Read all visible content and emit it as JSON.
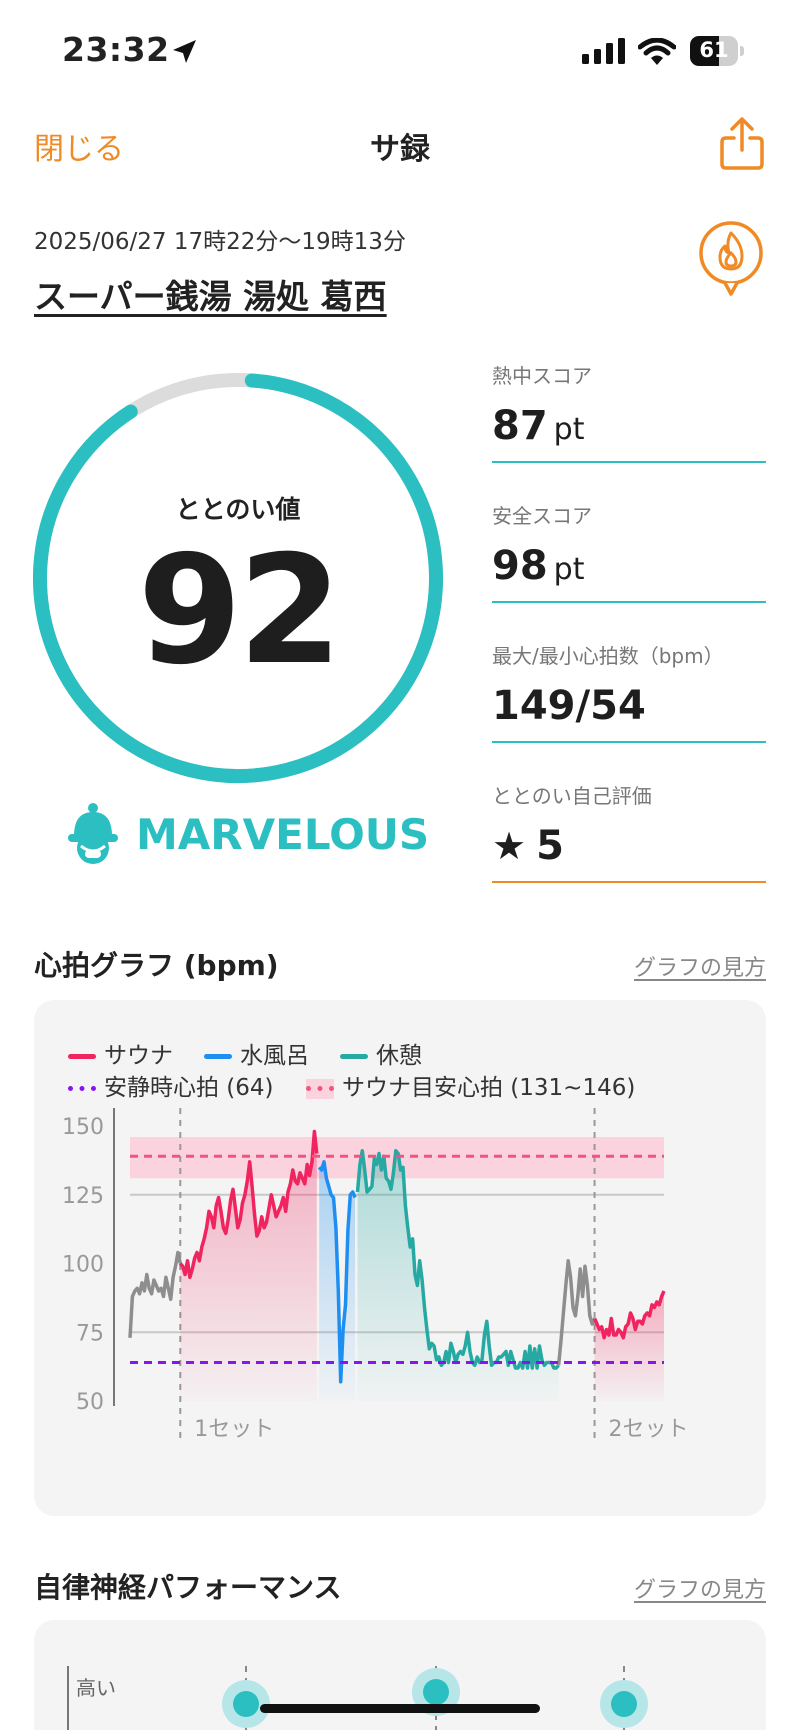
{
  "status_bar": {
    "time": "23:32",
    "battery": "61"
  },
  "nav": {
    "close_label": "閉じる",
    "title": "サ録"
  },
  "session": {
    "datetime": "2025/06/27 17時22分〜19時13分",
    "facility": "スーパー銭湯 湯処 葛西"
  },
  "score": {
    "label": "ととのい値",
    "value": "92",
    "progress": 0.92,
    "rating": "MARVELOUS"
  },
  "metrics": [
    {
      "label": "熱中スコア",
      "value": "87",
      "unit": "pt"
    },
    {
      "label": "安全スコア",
      "value": "98",
      "unit": "pt"
    },
    {
      "label": "最大/最小心拍数（bpm）",
      "value": "149/54",
      "unit": ""
    },
    {
      "label": "ととのい自己評価",
      "value": "5",
      "unit": ""
    }
  ],
  "heart_section": {
    "title": "心拍グラフ (bpm)",
    "link": "グラフの見方"
  },
  "autonomic_section": {
    "title": "自律神経パフォーマンス",
    "link": "グラフの見方",
    "y_high": "高い"
  },
  "colors": {
    "accent": "#2bbfc2",
    "orange": "#f08a24",
    "sauna": "#f0245f",
    "water": "#1e8ff0",
    "rest": "#26a9a2",
    "resting_hr": "#8a14f0",
    "target_hr": "#ee5582",
    "other": "#8e8e8e"
  },
  "chart_data": {
    "type": "line",
    "ylim": [
      50,
      150
    ],
    "yticks": [
      150,
      125,
      100,
      75,
      50
    ],
    "legend": [
      {
        "name": "サウナ",
        "color": "#f0245f",
        "style": "solid"
      },
      {
        "name": "水風呂",
        "color": "#1e8ff0",
        "style": "solid"
      },
      {
        "name": "休憩",
        "color": "#26a9a2",
        "style": "solid"
      },
      {
        "name": "安静時心拍 (64)",
        "color": "#8a14f0",
        "style": "dotted"
      },
      {
        "name": "サウナ目安心拍 (131~146)",
        "color": "#ee5582",
        "style": "dotted"
      }
    ],
    "resting_hr": 64,
    "target_band": [
      131,
      146
    ],
    "target_line": 139,
    "set_labels": [
      "1セット",
      "2セット"
    ],
    "x": [
      0,
      0.5,
      1,
      1.5,
      2,
      2.5,
      3,
      3.5,
      4,
      4.5,
      5,
      5.5,
      6,
      6.5,
      7,
      7.5,
      8,
      8.5,
      9,
      9.5,
      10,
      10.5,
      11,
      11.5,
      12,
      12.5,
      13,
      13.5,
      14,
      14.5,
      15,
      15.5,
      16,
      16.5,
      17,
      17.5,
      18,
      18.5,
      19,
      19.5,
      20,
      20.5,
      21,
      21.5,
      22,
      22.5,
      23,
      23.5,
      24,
      24.5,
      25,
      25.5,
      26,
      26.5,
      27,
      27.5,
      28,
      28.5,
      29,
      29.5,
      30,
      30.5,
      31,
      31.5,
      32,
      32.5,
      33,
      33.5,
      34,
      34.5,
      35,
      35.5,
      36,
      36.5,
      37,
      37.5,
      38,
      38.5,
      39,
      39.5,
      40,
      40.5,
      41,
      41.5,
      42,
      42.5,
      43,
      43.5,
      44,
      44.5,
      45,
      45.5,
      46,
      46.5,
      47,
      47.5,
      48,
      48.5,
      49,
      49.5,
      50,
      50.5,
      51,
      51.5,
      52,
      52.5,
      53,
      53.5,
      54,
      54.5,
      55,
      55.5,
      56,
      56.5,
      57,
      57.5,
      58,
      58.5,
      59,
      59.5,
      60,
      60.5,
      61,
      61.5,
      62,
      62.5,
      63,
      63.5,
      64,
      64.5,
      65,
      65.5,
      66,
      66.5,
      67,
      67.5,
      68,
      68.5,
      69,
      69.5,
      70,
      70.5,
      71,
      71.5,
      72,
      72.5,
      73,
      73.5,
      74,
      74.5,
      75,
      75.5,
      76,
      76.5,
      77,
      77.5,
      78,
      78.5,
      79,
      79.5,
      80,
      80.5,
      81,
      81.5,
      82,
      82.5,
      83,
      83.5,
      84,
      84.5,
      85,
      85.5,
      86,
      86.5,
      87,
      87.5,
      88,
      88.5,
      89,
      89.5,
      90,
      90.5,
      91,
      91.5,
      92,
      92.5,
      93,
      93.5,
      94,
      94.5,
      95,
      95.5,
      96,
      96.5,
      97,
      97.5,
      98,
      98.5,
      99,
      99.5,
      100,
      100.5,
      101,
      101.5,
      102,
      102.5,
      103,
      103.5,
      104,
      104.5,
      105,
      105.5,
      106,
      106.5,
      107,
      107.5,
      108,
      108.5,
      109,
      109.5,
      110,
      110.5,
      111,
      111.5
    ],
    "series": [
      {
        "name": "その他",
        "color": "#8e8e8e",
        "segments": [
          [
            0,
            73
          ],
          [
            0.5,
            88
          ],
          [
            1,
            90
          ],
          [
            1.5,
            91
          ],
          [
            2,
            89
          ],
          [
            2.5,
            93
          ],
          [
            3,
            90
          ],
          [
            3.5,
            96
          ],
          [
            4,
            91
          ],
          [
            4.5,
            89
          ],
          [
            5,
            94
          ],
          [
            5.5,
            92
          ],
          [
            6,
            90
          ],
          [
            6.5,
            91
          ],
          [
            7,
            88
          ],
          [
            7.5,
            95
          ],
          [
            8,
            91
          ],
          [
            8.5,
            87
          ],
          [
            9,
            95
          ],
          [
            9.5,
            99
          ],
          [
            10,
            104
          ],
          [
            10.5,
            100
          ]
        ]
      },
      {
        "name": "サウナ",
        "color": "#f0245f",
        "segments": [
          [
            10.5,
            100
          ],
          [
            11,
            99
          ],
          [
            11.5,
            96
          ],
          [
            12,
            101
          ],
          [
            12.5,
            95
          ],
          [
            13,
            98
          ],
          [
            13.5,
            102
          ],
          [
            14,
            104
          ],
          [
            14.5,
            101
          ],
          [
            15,
            106
          ],
          [
            15.5,
            109
          ],
          [
            16,
            113
          ],
          [
            16.5,
            119
          ],
          [
            17,
            117
          ],
          [
            17.5,
            113
          ],
          [
            18,
            121
          ],
          [
            18.5,
            124
          ],
          [
            19,
            119
          ],
          [
            19.5,
            113
          ],
          [
            20,
            111
          ],
          [
            20.5,
            116
          ],
          [
            21,
            123
          ],
          [
            21.5,
            127
          ],
          [
            22,
            120
          ],
          [
            22.5,
            113
          ],
          [
            23,
            116
          ],
          [
            23.5,
            122
          ],
          [
            24,
            125
          ],
          [
            24.5,
            130
          ],
          [
            25,
            137
          ],
          [
            25.5,
            128
          ],
          [
            26,
            118
          ],
          [
            26.5,
            110
          ],
          [
            27,
            112
          ],
          [
            27.5,
            117
          ],
          [
            28,
            113
          ],
          [
            28.5,
            115
          ],
          [
            29,
            120
          ],
          [
            29.5,
            125
          ],
          [
            30,
            121
          ],
          [
            30.5,
            117
          ],
          [
            31,
            119
          ],
          [
            31.5,
            121
          ],
          [
            32,
            124
          ],
          [
            32.5,
            119
          ],
          [
            33,
            126
          ],
          [
            33.5,
            129
          ],
          [
            34,
            134
          ],
          [
            34.5,
            130
          ],
          [
            35,
            129
          ],
          [
            35.5,
            133
          ],
          [
            36,
            131
          ],
          [
            36.5,
            129
          ],
          [
            37,
            136
          ],
          [
            37.5,
            132
          ],
          [
            38,
            137
          ],
          [
            38.5,
            148
          ],
          [
            39,
            140
          ]
        ]
      },
      {
        "name": "水風呂",
        "color": "#1e8ff0",
        "segments": [
          [
            39.5,
            135
          ],
          [
            40,
            134
          ],
          [
            40.5,
            137
          ],
          [
            41,
            131
          ],
          [
            41.5,
            128
          ],
          [
            42,
            125
          ],
          [
            42.5,
            124
          ],
          [
            43,
            113
          ],
          [
            43.5,
            90
          ],
          [
            44,
            57
          ],
          [
            44.5,
            76
          ],
          [
            45,
            85
          ],
          [
            45.5,
            112
          ],
          [
            46,
            125
          ],
          [
            46.5,
            126
          ],
          [
            47,
            124
          ]
        ]
      },
      {
        "name": "休憩",
        "color": "#26a9a2",
        "segments": [
          [
            47.5,
            126
          ],
          [
            48,
            136
          ],
          [
            48.5,
            141
          ],
          [
            49,
            134
          ],
          [
            49.5,
            126
          ],
          [
            50,
            127
          ],
          [
            50.5,
            128
          ],
          [
            51,
            138
          ],
          [
            51.5,
            136
          ],
          [
            52,
            140
          ],
          [
            52.5,
            134
          ],
          [
            53,
            139
          ],
          [
            53.5,
            131
          ],
          [
            54,
            130
          ],
          [
            54.5,
            127
          ],
          [
            55,
            133
          ],
          [
            55.5,
            141
          ],
          [
            56,
            140
          ],
          [
            56.5,
            134
          ],
          [
            57,
            135
          ],
          [
            57.5,
            121
          ],
          [
            58,
            113
          ],
          [
            58.5,
            106
          ],
          [
            59,
            109
          ],
          [
            59.5,
            96
          ],
          [
            60,
            92
          ],
          [
            60.5,
            101
          ],
          [
            61,
            94
          ],
          [
            61.5,
            84
          ],
          [
            62,
            76
          ],
          [
            62.5,
            69
          ],
          [
            63,
            71
          ],
          [
            63.5,
            70
          ],
          [
            64,
            65
          ],
          [
            64.5,
            66
          ],
          [
            65,
            63
          ],
          [
            65.5,
            64
          ],
          [
            66,
            68
          ],
          [
            66.5,
            64
          ],
          [
            67,
            71
          ],
          [
            67.5,
            68
          ],
          [
            68,
            64
          ],
          [
            68.5,
            67
          ],
          [
            69,
            68
          ],
          [
            69.5,
            67
          ],
          [
            70,
            70
          ],
          [
            70.5,
            75
          ],
          [
            71,
            68
          ],
          [
            71.5,
            64
          ],
          [
            72,
            63
          ],
          [
            72.5,
            66
          ],
          [
            73,
            64
          ],
          [
            73.5,
            65
          ],
          [
            74,
            74
          ],
          [
            74.5,
            79
          ],
          [
            75,
            70
          ],
          [
            75.5,
            63
          ],
          [
            76,
            64
          ],
          [
            76.5,
            64
          ],
          [
            77,
            66
          ],
          [
            77.5,
            66
          ],
          [
            78,
            67
          ],
          [
            78.5,
            68
          ],
          [
            79,
            63
          ],
          [
            79.5,
            68
          ],
          [
            80,
            65
          ],
          [
            80.5,
            62
          ],
          [
            81,
            62
          ],
          [
            81.5,
            64
          ],
          [
            82,
            62
          ],
          [
            82.5,
            68
          ],
          [
            83,
            62
          ],
          [
            83.5,
            70
          ],
          [
            84,
            62
          ],
          [
            84.5,
            69
          ],
          [
            85,
            62
          ],
          [
            85.5,
            70
          ],
          [
            86,
            65
          ],
          [
            86.5,
            63
          ],
          [
            87,
            64
          ],
          [
            87.5,
            64
          ],
          [
            88,
            64
          ],
          [
            88.5,
            62
          ],
          [
            89,
            62
          ],
          [
            89.5,
            63
          ]
        ]
      },
      {
        "name": "その他2",
        "color": "#8e8e8e",
        "segments": [
          [
            89.5,
            63
          ],
          [
            90,
            72
          ],
          [
            90.5,
            82
          ],
          [
            91,
            92
          ],
          [
            91.5,
            101
          ],
          [
            92,
            95
          ],
          [
            92.5,
            84
          ],
          [
            93,
            81
          ],
          [
            93.5,
            88
          ],
          [
            94,
            98
          ],
          [
            94.5,
            88
          ],
          [
            95,
            99
          ],
          [
            95.5,
            92
          ],
          [
            96,
            81
          ],
          [
            96.5,
            78
          ],
          [
            97,
            80
          ]
        ]
      },
      {
        "name": "サウナ2",
        "color": "#f0245f",
        "segments": [
          [
            97,
            80
          ],
          [
            97.5,
            78
          ],
          [
            98,
            76
          ],
          [
            98.5,
            77
          ],
          [
            99,
            73
          ],
          [
            99.5,
            76
          ],
          [
            100,
            74
          ],
          [
            100.5,
            80
          ],
          [
            101,
            74
          ],
          [
            101.5,
            74
          ],
          [
            102,
            76
          ],
          [
            102.5,
            75
          ],
          [
            103,
            73
          ],
          [
            103.5,
            77
          ],
          [
            104,
            78
          ],
          [
            104.5,
            82
          ],
          [
            105,
            80
          ],
          [
            105.5,
            76
          ],
          [
            106,
            79
          ],
          [
            106.5,
            79
          ],
          [
            107,
            78
          ],
          [
            107.5,
            81
          ],
          [
            108,
            82
          ],
          [
            108.5,
            81
          ],
          [
            109,
            85
          ],
          [
            109.5,
            84
          ],
          [
            110,
            86
          ],
          [
            110.5,
            85
          ],
          [
            111,
            88
          ],
          [
            111.5,
            90
          ]
        ]
      }
    ]
  }
}
